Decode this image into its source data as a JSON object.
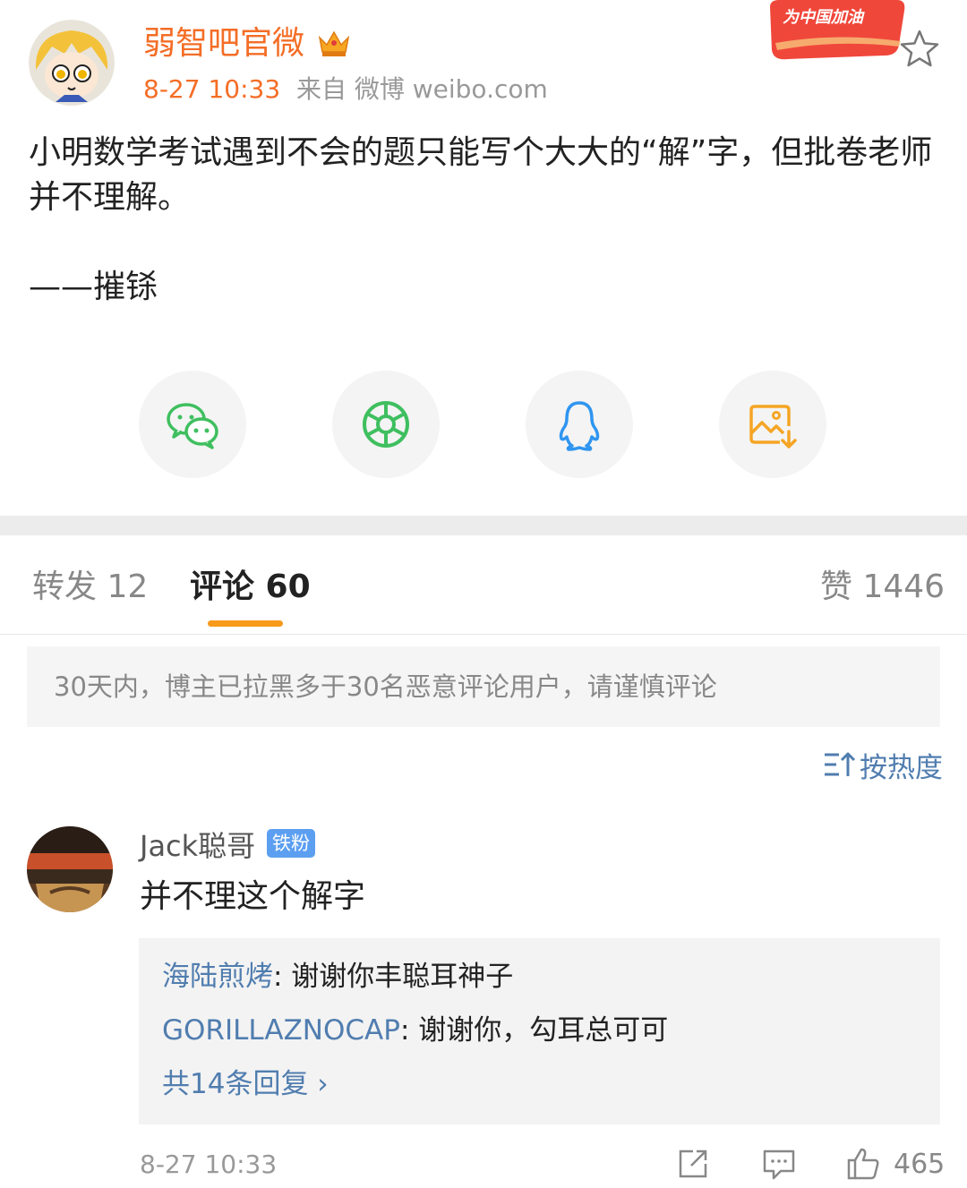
{
  "post": {
    "author": "弱智吧官微",
    "time": "8-27 10:33",
    "source": "来自 微博 weibo.com",
    "promo_badge": "为中国加油",
    "text": "小明数学考试遇到不会的题只能写个大大的“解”字，但批卷老师并不理解。",
    "signature": "——摧铩"
  },
  "share_icons": [
    "wechat-icon",
    "moments-icon",
    "qq-icon",
    "save-image-icon"
  ],
  "tabs": {
    "repost": "转发 12",
    "comments": "评论 60",
    "likes": "赞 1446"
  },
  "notice": "30天内，博主已拉黑多于30名恶意评论用户，请谨慎评论",
  "sort_label": "按热度",
  "comment": {
    "user": "Jack聪哥",
    "badge": "铁粉",
    "text": "并不理这个解字",
    "replies": [
      {
        "user": "海陆煎烤",
        "text": ": 谢谢你丰聪耳神子"
      },
      {
        "user": "GORILLAZNOCAP",
        "text": ": 谢谢你，勾耳总可可"
      }
    ],
    "more_replies": "共14条回复 ›",
    "time": "8-27 10:33",
    "likes": "465"
  },
  "colors": {
    "accent_orange": "#f46d26",
    "link_blue": "#507daf",
    "tab_indicator": "#f89a1c",
    "badge_blue": "#5c9ff0"
  }
}
